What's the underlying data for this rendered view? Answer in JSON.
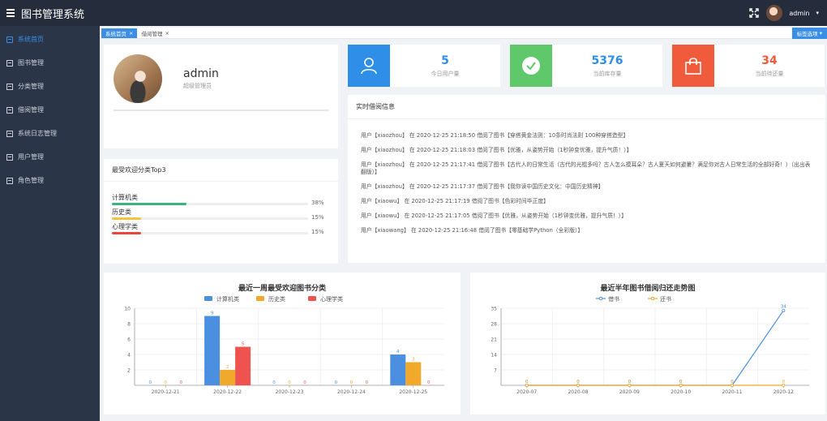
{
  "app": {
    "title": "图书管理系统"
  },
  "topbar": {
    "user_name": "admin",
    "caret": "▾"
  },
  "sidebar": {
    "items": [
      {
        "label": "系统首页",
        "active": true
      },
      {
        "label": "图书管理",
        "active": false
      },
      {
        "label": "分类管理",
        "active": false
      },
      {
        "label": "借阅管理",
        "active": false
      },
      {
        "label": "系统日志管理",
        "active": false
      },
      {
        "label": "用户管理",
        "active": false
      },
      {
        "label": "角色管理",
        "active": false
      }
    ]
  },
  "tabs": {
    "items": [
      {
        "label": "系统首页",
        "active": true
      },
      {
        "label": "借阅管理",
        "active": false
      }
    ],
    "close": "×",
    "ops_label": "标签选项"
  },
  "profile": {
    "name": "admin",
    "role": "超级管理员"
  },
  "top3": {
    "title": "最受欢迎分类Top3",
    "items": [
      {
        "label": "计算机类",
        "percent": 38,
        "percent_text": "38%",
        "color": "#3cb37a"
      },
      {
        "label": "历史类",
        "percent": 15,
        "percent_text": "15%",
        "color": "#f5c242"
      },
      {
        "label": "心理学类",
        "percent": 15,
        "percent_text": "15%",
        "color": "#e8463a"
      }
    ]
  },
  "stats": [
    {
      "value": "5",
      "label": "今日用户量",
      "icon": "user-icon",
      "color": "#2f8ee8",
      "value_color": "#2f8ee8"
    },
    {
      "value": "5376",
      "label": "当前库存量",
      "icon": "check-circle-icon",
      "color": "#5ec86a",
      "value_color": "#2f8ee8"
    },
    {
      "value": "34",
      "label": "当前待还量",
      "icon": "bag-icon",
      "color": "#ef5b3b",
      "value_color": "#ef5b3b"
    }
  ],
  "realtime": {
    "title": "实时借阅信息",
    "items": [
      "用户【xiaozhou】 在 2020-12-25 21:18:50 借阅了图书【穿搭黄金法则：10条时尚法则 100种穿搭造型】",
      "用户【xiaozhou】 在 2020-12-25 21:18:03 借阅了图书【优雅，从姿势开始（1秒钟变优雅，提升气质！）】",
      "用户【xiaozhou】 在 2020-12-25 21:17:41 借阅了图书【古代人的日常生活（古代的光棍多吗？古人怎么摸耳朵？古人夏天如何避暑？满足你对古人日常生活的全部好奇！）（出出表翻版）】",
      "用户【xiaozhou】 在 2020-12-25 21:17:37 借阅了图书【我你读中国历史文化：中国历史精神】",
      "用户【xiaowu】 在 2020-12-25 21:17:19 借阅了图书【色彩时间毕正度】",
      "用户【xiaowu】 在 2020-12-25 21:17:05 借阅了图书【优雅，从姿势开始（1秒钟变优雅，提升气质！）】",
      "用户【xiaowang】 在 2020-12-25 21:16:48 借阅了图书【零基础学Python（全彩版）】"
    ]
  },
  "chart_data": [
    {
      "type": "bar",
      "title": "最近一周最受欢迎图书分类",
      "categories": [
        "2020-12-21",
        "2020-12-22",
        "2020-12-23",
        "2020-12-24",
        "2020-12-25"
      ],
      "series": [
        {
          "name": "计算机类",
          "values": [
            0,
            9,
            0,
            0,
            4
          ],
          "color": "#4a8fe0"
        },
        {
          "name": "历史类",
          "values": [
            0,
            2,
            0,
            0,
            3
          ],
          "color": "#f0a92b"
        },
        {
          "name": "心理学类",
          "values": [
            0,
            5,
            0,
            0,
            0
          ],
          "color": "#ef5350"
        }
      ],
      "ylim": [
        0,
        10
      ],
      "yticks": [
        2,
        4,
        6,
        8,
        10
      ],
      "legend": "top-center",
      "grid": true
    },
    {
      "type": "line",
      "title": "最近半年图书借阅归还走势图",
      "categories": [
        "2020-07",
        "2020-08",
        "2020-09",
        "2020-10",
        "2020-11",
        "2020-12"
      ],
      "series": [
        {
          "name": "借书",
          "values": [
            0,
            0,
            0,
            0,
            0,
            34
          ],
          "color": "#4a8fe0"
        },
        {
          "name": "还书",
          "values": [
            0,
            0,
            0,
            0,
            0,
            0
          ],
          "color": "#f0a92b"
        }
      ],
      "ylim": [
        0,
        35
      ],
      "yticks": [
        7,
        14,
        21,
        28,
        35
      ],
      "legend": "top-center",
      "grid": true
    }
  ]
}
